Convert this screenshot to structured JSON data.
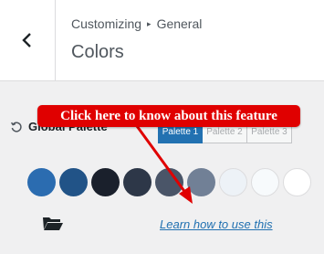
{
  "header": {
    "breadcrumb": {
      "parent": "Customizing",
      "separator": "▸",
      "current": "General"
    },
    "title": "Colors"
  },
  "palette": {
    "label": "Global Palette",
    "tabs": [
      {
        "label": "Palette 1",
        "active": true
      },
      {
        "label": "Palette 2",
        "active": false
      },
      {
        "label": "Palette 3",
        "active": false
      }
    ],
    "swatches": [
      "#2b6cb0",
      "#215387",
      "#1a202c",
      "#2d3748",
      "#4a5568",
      "#718096",
      "#edf2f7",
      "#f7fafc",
      "#ffffff"
    ]
  },
  "learn_link": "Learn how to use this",
  "callout": "Click here to know about this feature",
  "colors": {
    "accent": "#2271b1",
    "callout": "#e00000"
  }
}
